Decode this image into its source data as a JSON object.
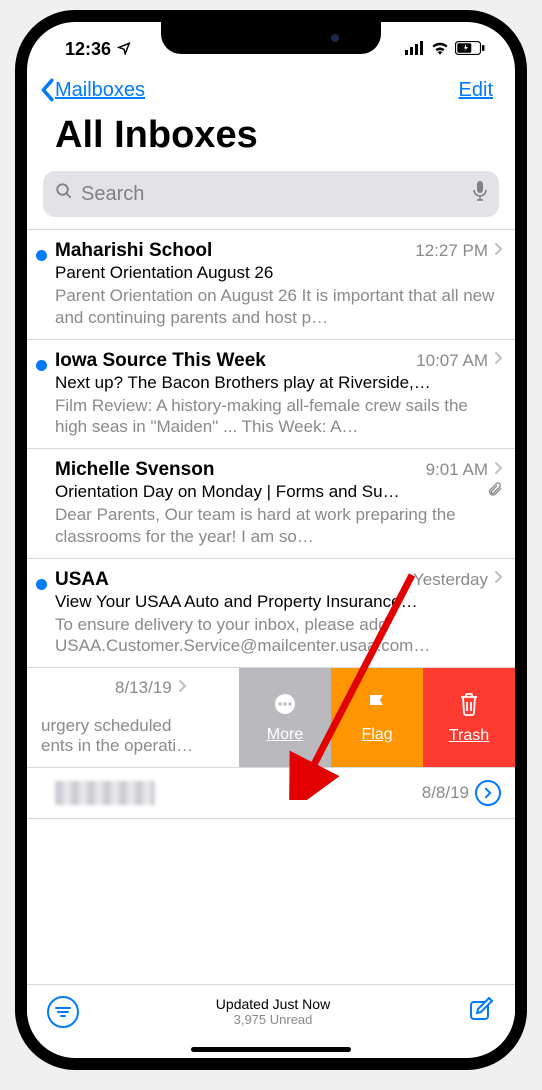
{
  "status": {
    "time": "12:36"
  },
  "nav": {
    "back_label": "Mailboxes",
    "edit_label": "Edit"
  },
  "title": "All Inboxes",
  "search": {
    "placeholder": "Search"
  },
  "emails": [
    {
      "sender": "Maharishi School",
      "time": "12:27 PM",
      "unread": true,
      "subject": "Parent Orientation August 26",
      "preview": "Parent Orientation on August 26 It is important that all new and continuing parents and host p…"
    },
    {
      "sender": "Iowa Source This Week",
      "time": "10:07 AM",
      "unread": true,
      "subject": "Next up? The Bacon Brothers play at Riverside,…",
      "preview": "Film Review: A history-making all-female crew sails the high seas in \"Maiden\" ... This Week: A…"
    },
    {
      "sender": "Michelle Svenson",
      "time": "9:01 AM",
      "unread": false,
      "attachment": true,
      "subject": "Orientation Day on Monday | Forms and Su…",
      "preview": "Dear Parents, Our team is hard at work preparing the classrooms for the year! I am so…"
    },
    {
      "sender": "USAA",
      "time": "Yesterday",
      "unread": true,
      "subject": "View Your USAA Auto and Property Insurance…",
      "preview": "To ensure delivery to your inbox, please add USAA.Customer.Service@mailcenter.usaa.com…"
    }
  ],
  "swipe": {
    "date": "8/13/19",
    "preview_line1": "urgery scheduled",
    "preview_line2": "ents in the operati…",
    "more_label": "More",
    "flag_label": "Flag",
    "trash_label": "Trash"
  },
  "blurred": {
    "date": "8/8/19"
  },
  "toolbar": {
    "updated": "Updated Just Now",
    "unread": "3,975 Unread"
  }
}
